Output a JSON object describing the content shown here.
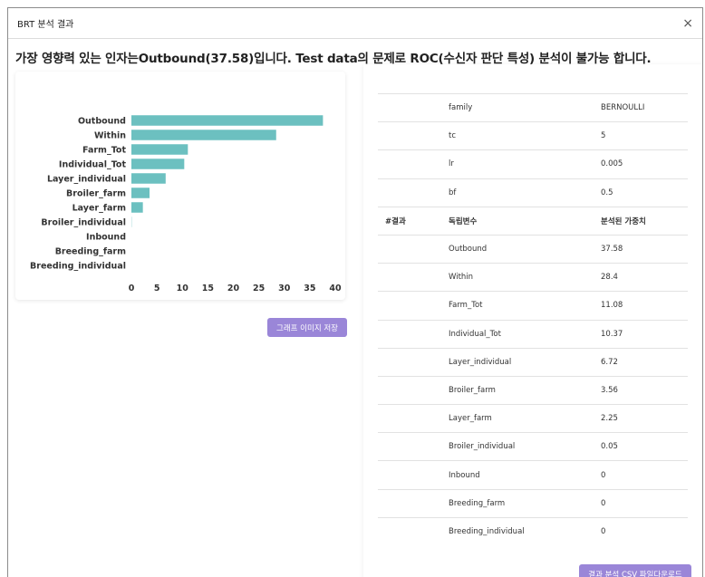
{
  "modal": {
    "title": "BRT 분석 결과",
    "close_label": "×"
  },
  "headline": "가장 영향력 있는 인자는Outbound(37.58)입니다. Test data의 문제로 ROC(수신자 판단 특성) 분석이 불가능 합니다.",
  "chart_data": {
    "type": "bar",
    "orientation": "horizontal",
    "categories": [
      "Outbound",
      "Within",
      "Farm_Tot",
      "Individual_Tot",
      "Layer_individual",
      "Broiler_farm",
      "Layer_farm",
      "Broiler_individual",
      "Inbound",
      "Breeding_farm",
      "Breeding_individual"
    ],
    "values": [
      37.58,
      28.4,
      11.08,
      10.37,
      6.72,
      3.56,
      2.25,
      0.05,
      0,
      0,
      0
    ],
    "xlim": [
      0,
      40
    ],
    "xticks": [
      0,
      5,
      10,
      15,
      20,
      25,
      30,
      35,
      40
    ],
    "bar_color": "#6cc0c0",
    "grid": false
  },
  "buttons": {
    "save_graph": "그래프 이미지 저장",
    "download_csv": "결과 분석 CSV 파일다운로드"
  },
  "params": [
    {
      "key": "family",
      "value": "BERNOULLI"
    },
    {
      "key": "tc",
      "value": "5"
    },
    {
      "key": "lr",
      "value": "0.005"
    },
    {
      "key": "bf",
      "value": "0.5"
    }
  ],
  "results_header": {
    "section": "#결과",
    "variable": "독립변수",
    "weight": "분석된 가중치"
  },
  "results": [
    {
      "variable": "Outbound",
      "weight": "37.58"
    },
    {
      "variable": "Within",
      "weight": "28.4"
    },
    {
      "variable": "Farm_Tot",
      "weight": "11.08"
    },
    {
      "variable": "Individual_Tot",
      "weight": "10.37"
    },
    {
      "variable": "Layer_individual",
      "weight": "6.72"
    },
    {
      "variable": "Broiler_farm",
      "weight": "3.56"
    },
    {
      "variable": "Layer_farm",
      "weight": "2.25"
    },
    {
      "variable": "Broiler_individual",
      "weight": "0.05"
    },
    {
      "variable": "Inbound",
      "weight": "0"
    },
    {
      "variable": "Breeding_farm",
      "weight": "0"
    },
    {
      "variable": "Breeding_individual",
      "weight": "0"
    }
  ]
}
